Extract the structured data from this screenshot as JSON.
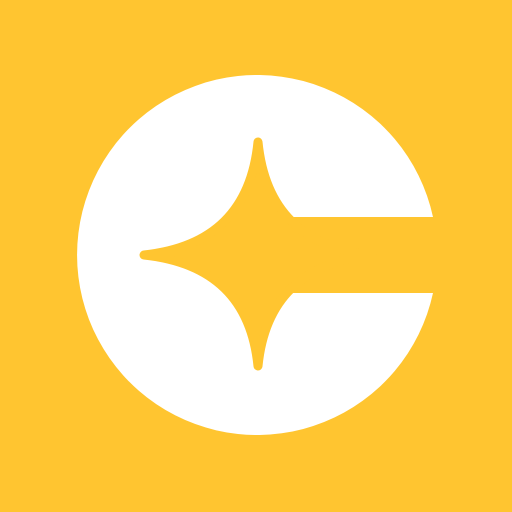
{
  "icon": {
    "name": "sparkle-logo-icon",
    "colors": {
      "background": "#FFC530",
      "disc": "#FFFFFF",
      "sparkle": "#FFC530"
    }
  }
}
